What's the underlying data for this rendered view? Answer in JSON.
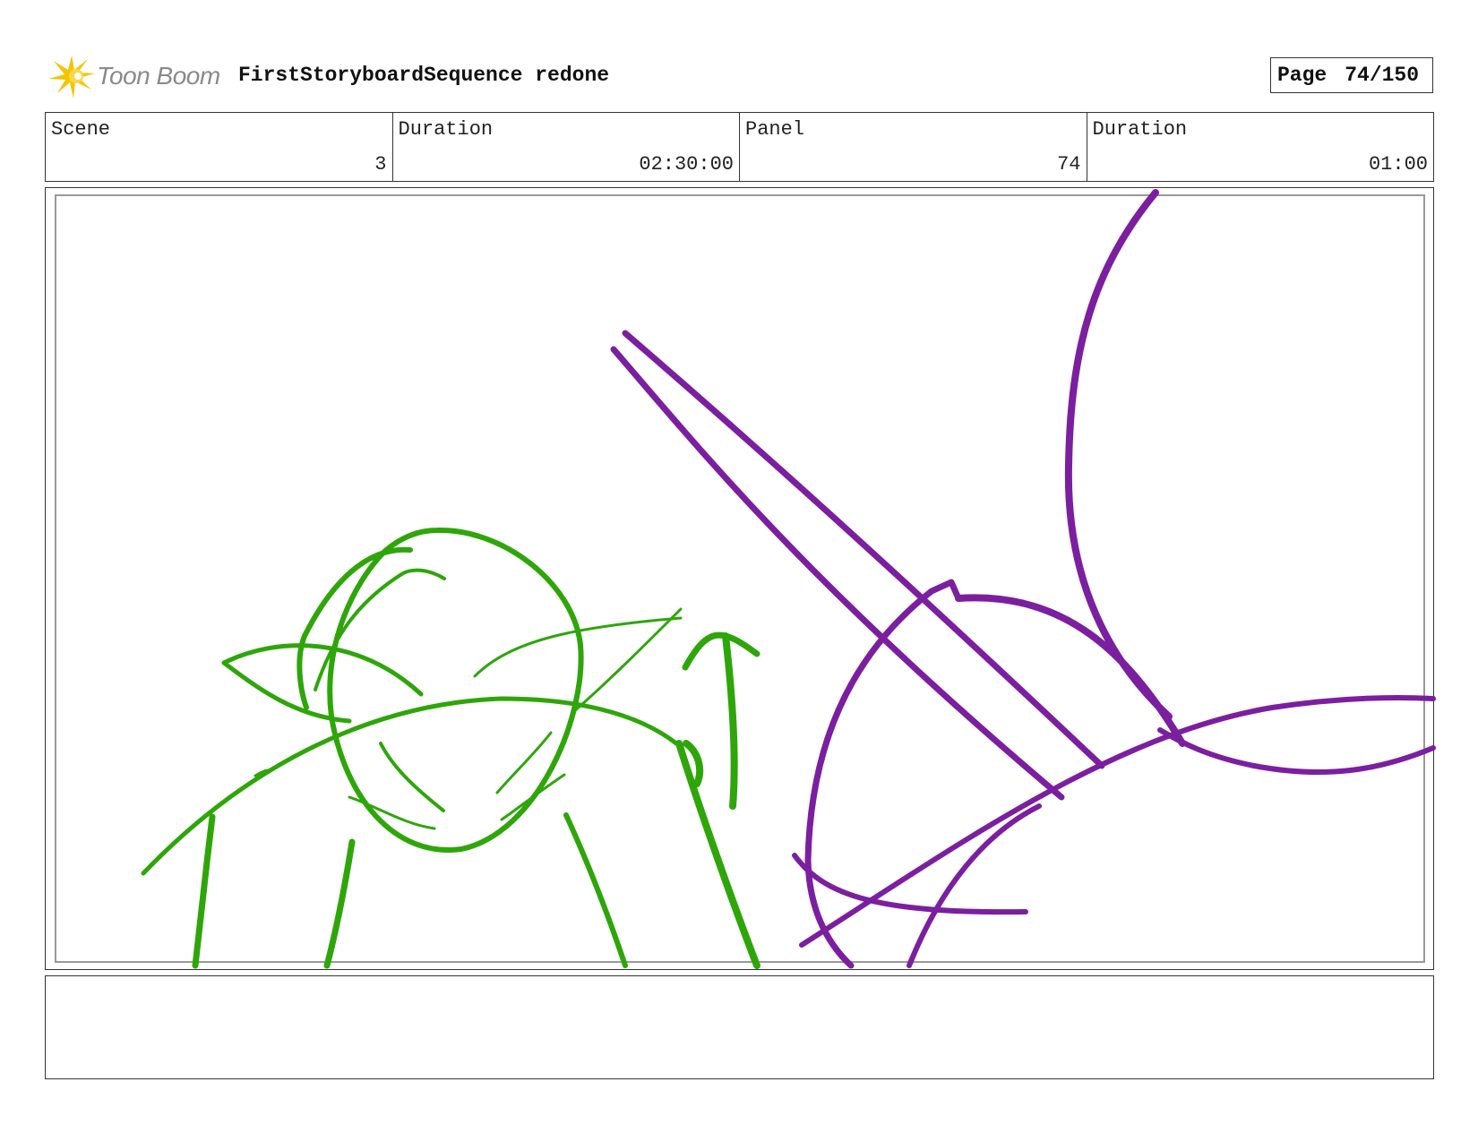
{
  "header": {
    "logo_text": "Toon Boom",
    "sequence_title": "FirstStoryboardSequence redone",
    "page_label": "Page",
    "page_number": "74/150"
  },
  "info": {
    "scene_label": "Scene",
    "scene_value": "3",
    "scene_duration_label": "Duration",
    "scene_duration_value": "02:30:00",
    "panel_label": "Panel",
    "panel_value": "74",
    "panel_duration_label": "Duration",
    "panel_duration_value": "01:00"
  },
  "colors": {
    "green_sketch": "#2ea60a",
    "purple_sketch": "#7b1fa0",
    "logo_star": "#f5c400"
  },
  "notes": {
    "text": ""
  }
}
